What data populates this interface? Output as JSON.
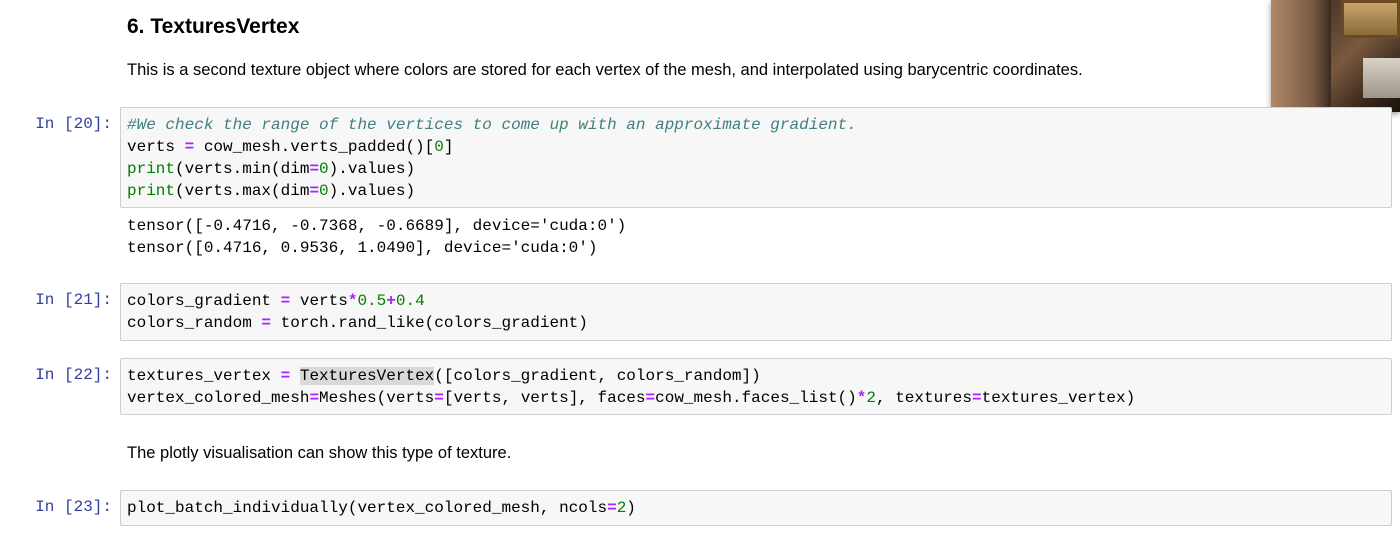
{
  "section": {
    "heading": "6. TexturesVertex",
    "description": "This is a second texture object where colors are stored for each vertex of the mesh, and interpolated using barycentric coordinates."
  },
  "cells": [
    {
      "prompt": "In [20]:",
      "code": [
        "#We check the range of the vertices to come up with an approximate gradient.",
        "verts = cow_mesh.verts_padded()[0]",
        "print(verts.min(dim=0).values)",
        "print(verts.max(dim=0).values)"
      ],
      "output": [
        "tensor([-0.4716, -0.7368, -0.6689], device='cuda:0')",
        "tensor([0.4716, 0.9536, 1.0490], device='cuda:0')"
      ]
    },
    {
      "prompt": "In [21]:",
      "code": [
        "colors_gradient = verts*0.5+0.4",
        "colors_random = torch.rand_like(colors_gradient)"
      ]
    },
    {
      "prompt": "In [22]:",
      "code": [
        "textures_vertex = TexturesVertex([colors_gradient, colors_random])",
        "vertex_colored_mesh=Meshes(verts=[verts, verts], faces=cow_mesh.faces_list()*2, textures=textures_vertex)"
      ]
    },
    {
      "prompt": "In [23]:",
      "code": [
        "plot_batch_individually(vertex_colored_mesh, ncols=2)"
      ]
    }
  ],
  "markdown2": "The plotly visualisation can show this type of texture.",
  "colors": {
    "prompt": "#303F9F",
    "comment": "#408080",
    "builtin": "#008000",
    "operator": "#AA22FF",
    "cell_bg": "#f7f7f7",
    "cell_border": "#cfcfcf"
  }
}
